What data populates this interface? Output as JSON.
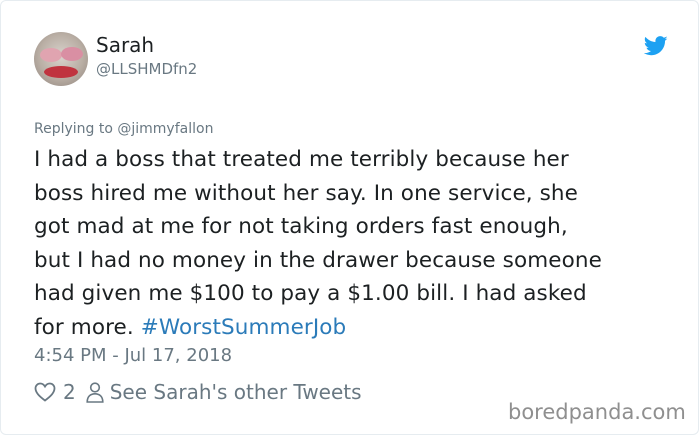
{
  "author": {
    "name": "Sarah",
    "handle": "@LLSHMDfn2"
  },
  "reply_to": "Replying to @jimmyfallon",
  "tweet": {
    "text": "I had a boss that treated me terribly because her\nboss hired me without her say. In one service, she\ngot mad at me for not taking orders fast enough,\nbut I had no money in the drawer because someone\nhad given me $100 to pay a $1.00 bill. I had asked\nfor more. ",
    "hashtag": "#WorstSummerJob",
    "timestamp": "4:54 PM - Jul 17, 2018"
  },
  "actions": {
    "like_count": "2",
    "other_tweets_label": "See Sarah's other Tweets"
  },
  "watermark": "boredpanda.com",
  "icons": {
    "logo": "twitter-bird-icon",
    "like": "heart-icon",
    "profile": "person-icon"
  },
  "colors": {
    "twitter_blue": "#1da1f2",
    "hashtag": "#2b7bb9",
    "secondary_text": "#697882"
  }
}
